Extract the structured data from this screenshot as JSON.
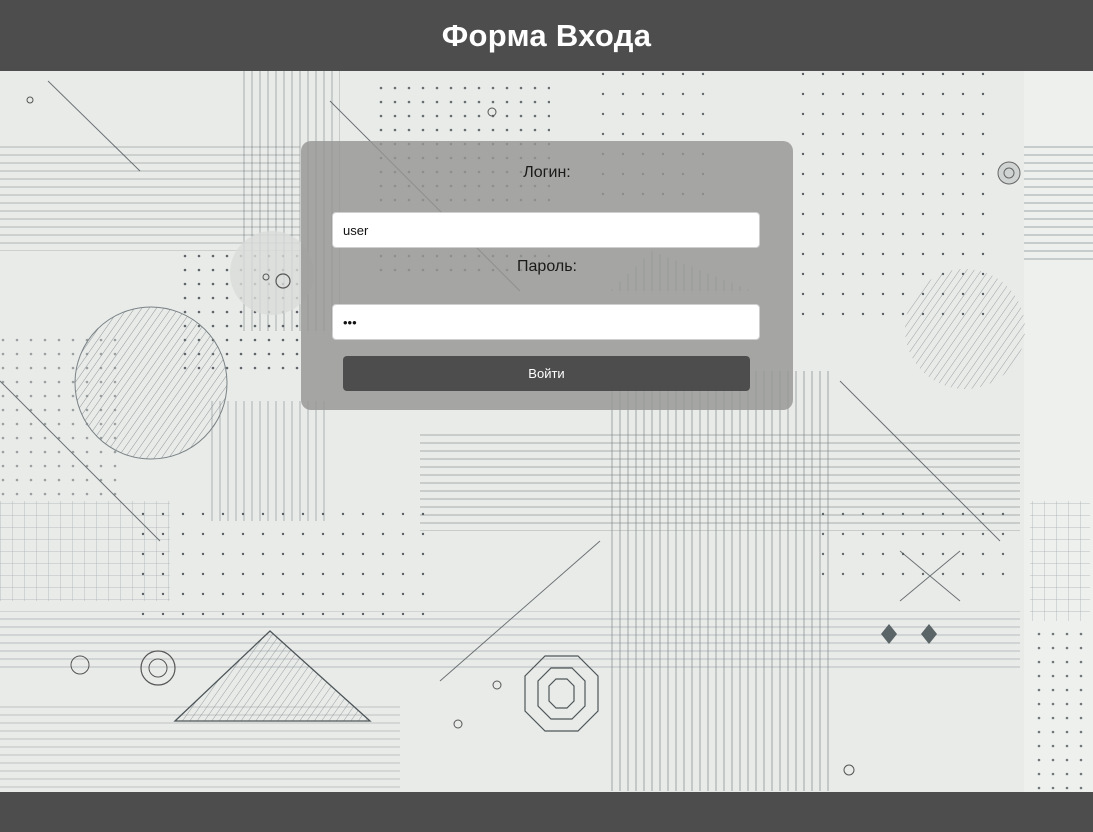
{
  "header": {
    "title": "Форма Входа"
  },
  "form": {
    "login_label": "Логин:",
    "login_value": "user",
    "password_label": "Пароль:",
    "password_value": "abc",
    "submit_label": "Войти"
  },
  "colors": {
    "bar": "#4d4d4d",
    "card": "#969694",
    "background": "#e9ebe9",
    "button": "#4d4d4d"
  }
}
